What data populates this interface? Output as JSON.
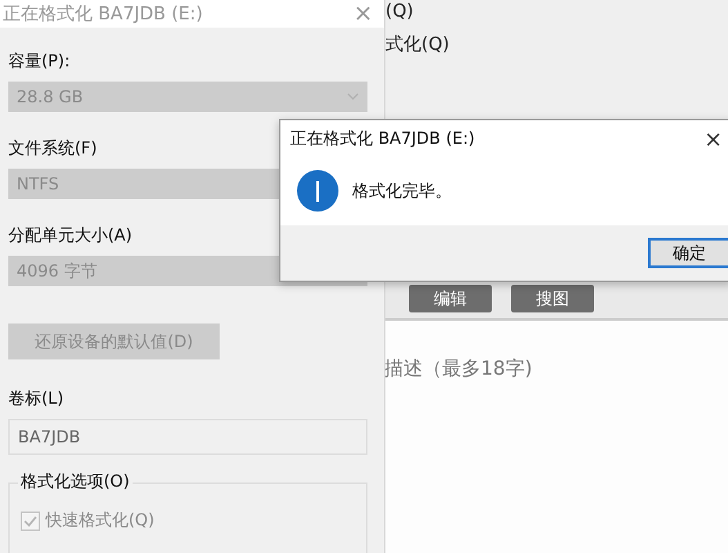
{
  "back_window": {
    "lines": [
      "(Q)",
      "式化(Q)"
    ],
    "buttons": [
      "编辑",
      "搜图"
    ],
    "description_placeholder": "描述（最多18字)"
  },
  "format_dialog": {
    "title": "正在格式化 BA7JDB (E:)",
    "close": "×",
    "fields": [
      {
        "label": "容量(P):",
        "value": "28.8 GB",
        "kind": "dropdown",
        "disabled": true
      },
      {
        "label": "文件系统(F)",
        "value": "NTFS",
        "kind": "dropdown",
        "disabled": true
      },
      {
        "label": "分配单元大小(A)",
        "value": "4096 字节",
        "kind": "dropdown",
        "disabled": true
      }
    ],
    "reset_button": {
      "label": "还原设备的默认值(D)",
      "disabled": true
    },
    "volume_label": {
      "label": "卷标(L)",
      "value": "BA7JDB"
    },
    "options": {
      "title": "格式化选项(O)",
      "checkbox": {
        "label": "快速格式化(Q)",
        "checked": true,
        "disabled": true
      }
    }
  },
  "message_box": {
    "title": "正在格式化 BA7JDB (E:)",
    "close": "×",
    "message": "格式化完毕。",
    "ok": "确定"
  }
}
